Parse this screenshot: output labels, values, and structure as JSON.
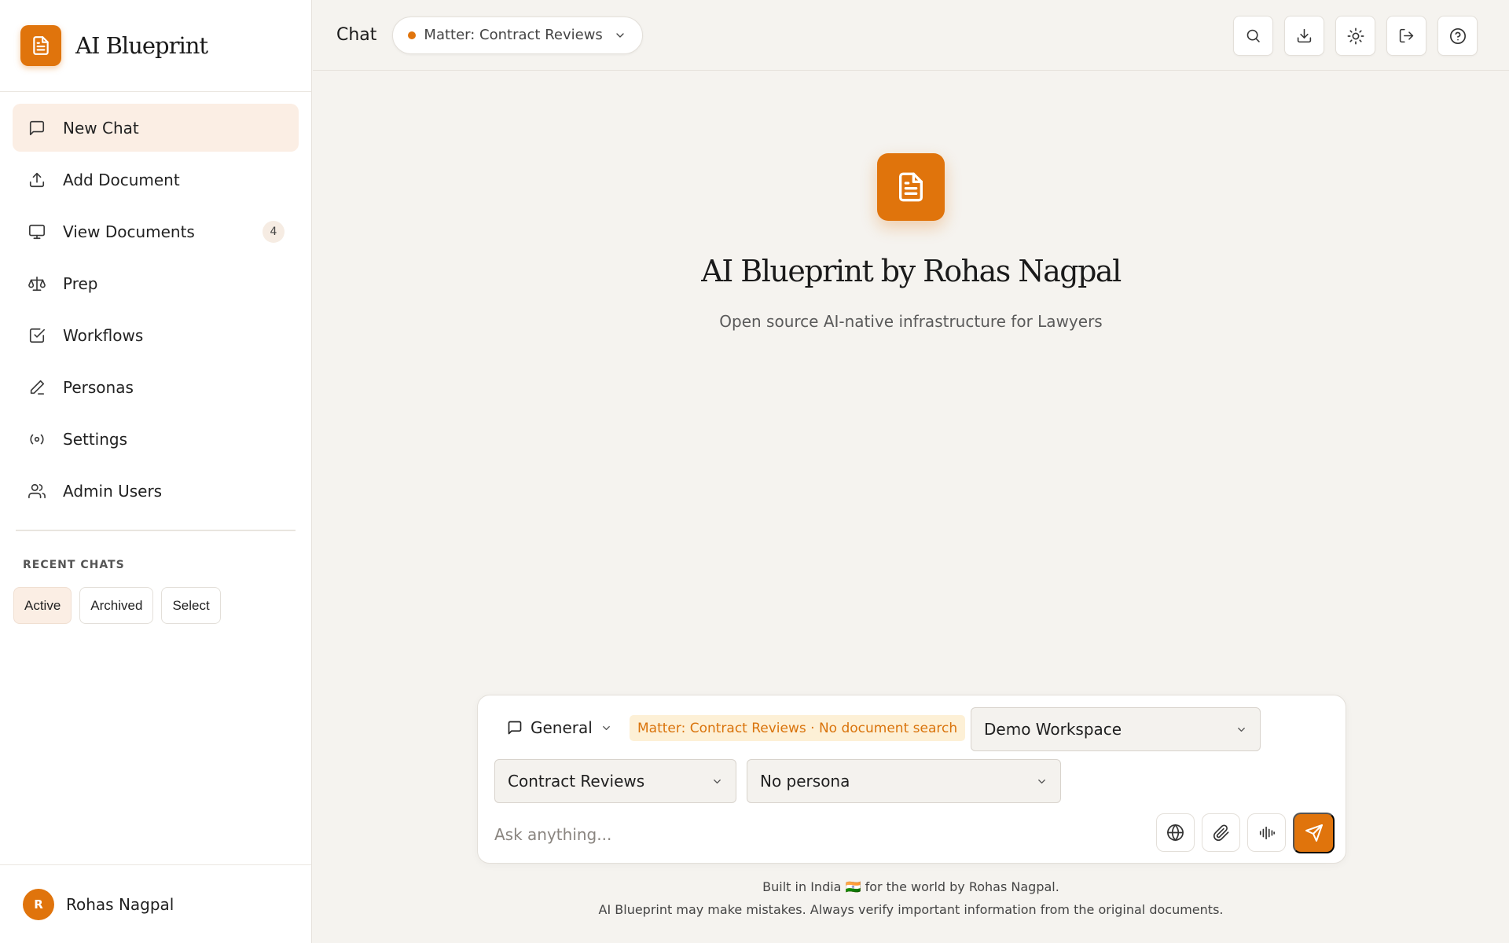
{
  "brand": {
    "name": "AI Blueprint"
  },
  "nav": {
    "items": [
      {
        "label": "New Chat",
        "icon": "chat-bubble-icon",
        "active": true
      },
      {
        "label": "Add Document",
        "icon": "upload-icon"
      },
      {
        "label": "View Documents",
        "icon": "monitor-icon",
        "badge": "4"
      },
      {
        "label": "Prep",
        "icon": "scale-icon"
      },
      {
        "label": "Workflows",
        "icon": "checkbox-icon"
      },
      {
        "label": "Personas",
        "icon": "pen-icon"
      },
      {
        "label": "Settings",
        "icon": "broadcast-icon"
      },
      {
        "label": "Admin Users",
        "icon": "users-icon"
      }
    ]
  },
  "recent": {
    "label": "RECENT CHATS",
    "filters": [
      "Active",
      "Archived",
      "Select"
    ],
    "active_filter": "Active"
  },
  "user": {
    "initial": "R",
    "name": "Rohas Nagpal"
  },
  "header": {
    "title": "Chat",
    "matter_select": "Matter: Contract Reviews",
    "actions": [
      "search-icon",
      "download-icon",
      "sun-icon",
      "logout-icon",
      "help-icon"
    ]
  },
  "hero": {
    "title": "AI Blueprint by Rohas Nagpal",
    "subtitle": "Open source AI-native infrastructure for Lawyers"
  },
  "composer": {
    "mode": "General",
    "matter_tag": "Matter: Contract Reviews · No document search",
    "workspace": "Demo Workspace",
    "matter": "Contract Reviews",
    "persona": "No persona",
    "placeholder": "Ask anything...",
    "value": ""
  },
  "footer": {
    "line1": "Built in India 🇮🇳 for the world by Rohas Nagpal.",
    "line2": "AI Blueprint may make mistakes. Always verify important information from the original documents."
  },
  "colors": {
    "accent": "#e0740c",
    "active_bg": "#fbeee4",
    "page_bg": "#f5f3ef"
  }
}
